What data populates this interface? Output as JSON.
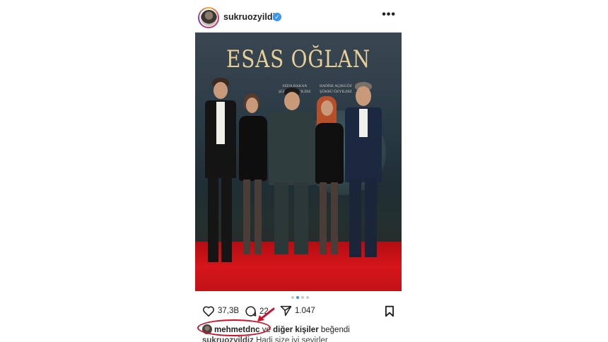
{
  "post": {
    "username": "sukruozyildiz",
    "more_label": "•••",
    "photo": {
      "title": "ESAS OĞLAN",
      "credit_left_1": "SEDA BAKAN",
      "credit_left_2": "ŞÜKRÜ ÖZYILDIZ",
      "credit_right_1": "HADİSE AÇIKGÖZ",
      "credit_right_2": "ŞÜKRÜ ÖZYILDIZ"
    },
    "likes_count": "37,3B",
    "comments_count": "22",
    "shares_count": "1.047",
    "liked_by_user": "mehmetdnc",
    "liked_by_connector": "ve",
    "liked_by_others": "diğer kişiler",
    "liked_by_suffix": "beğendi",
    "caption_user": "sukruozyildiz",
    "caption_text": "Hadi size iyi seyirler"
  },
  "colors": {
    "verified": "#3897f0",
    "annotation": "#d0102a"
  }
}
